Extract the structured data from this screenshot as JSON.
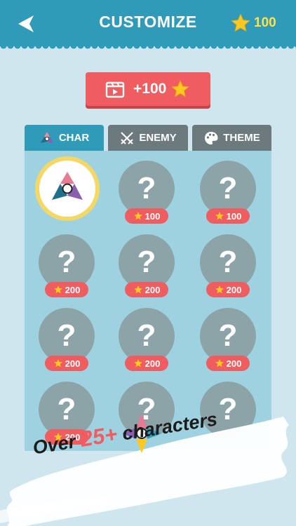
{
  "header": {
    "title": "CUSTOMIZE",
    "star_count": "100"
  },
  "reward": {
    "label": "+100"
  },
  "tabs": [
    {
      "label": "CHAR",
      "active": true
    },
    {
      "label": "ENEMY",
      "active": false
    },
    {
      "label": "THEME",
      "active": false
    }
  ],
  "grid": {
    "rows": [
      [
        "selected",
        "100",
        "100"
      ],
      [
        "200",
        "200",
        "200"
      ],
      [
        "200",
        "200",
        "200"
      ],
      [
        "200",
        "locked",
        "locked"
      ]
    ],
    "locked_mark": "?"
  },
  "banner": {
    "prefix": "Over ",
    "highlight": "25+",
    "suffix": " characters"
  },
  "colors": {
    "header": "#2f9bb8",
    "accent_red": "#ef5d60",
    "star": "#ffc81e",
    "locked_circle": "#8ca4a8",
    "panel": "#9fd2e1"
  }
}
